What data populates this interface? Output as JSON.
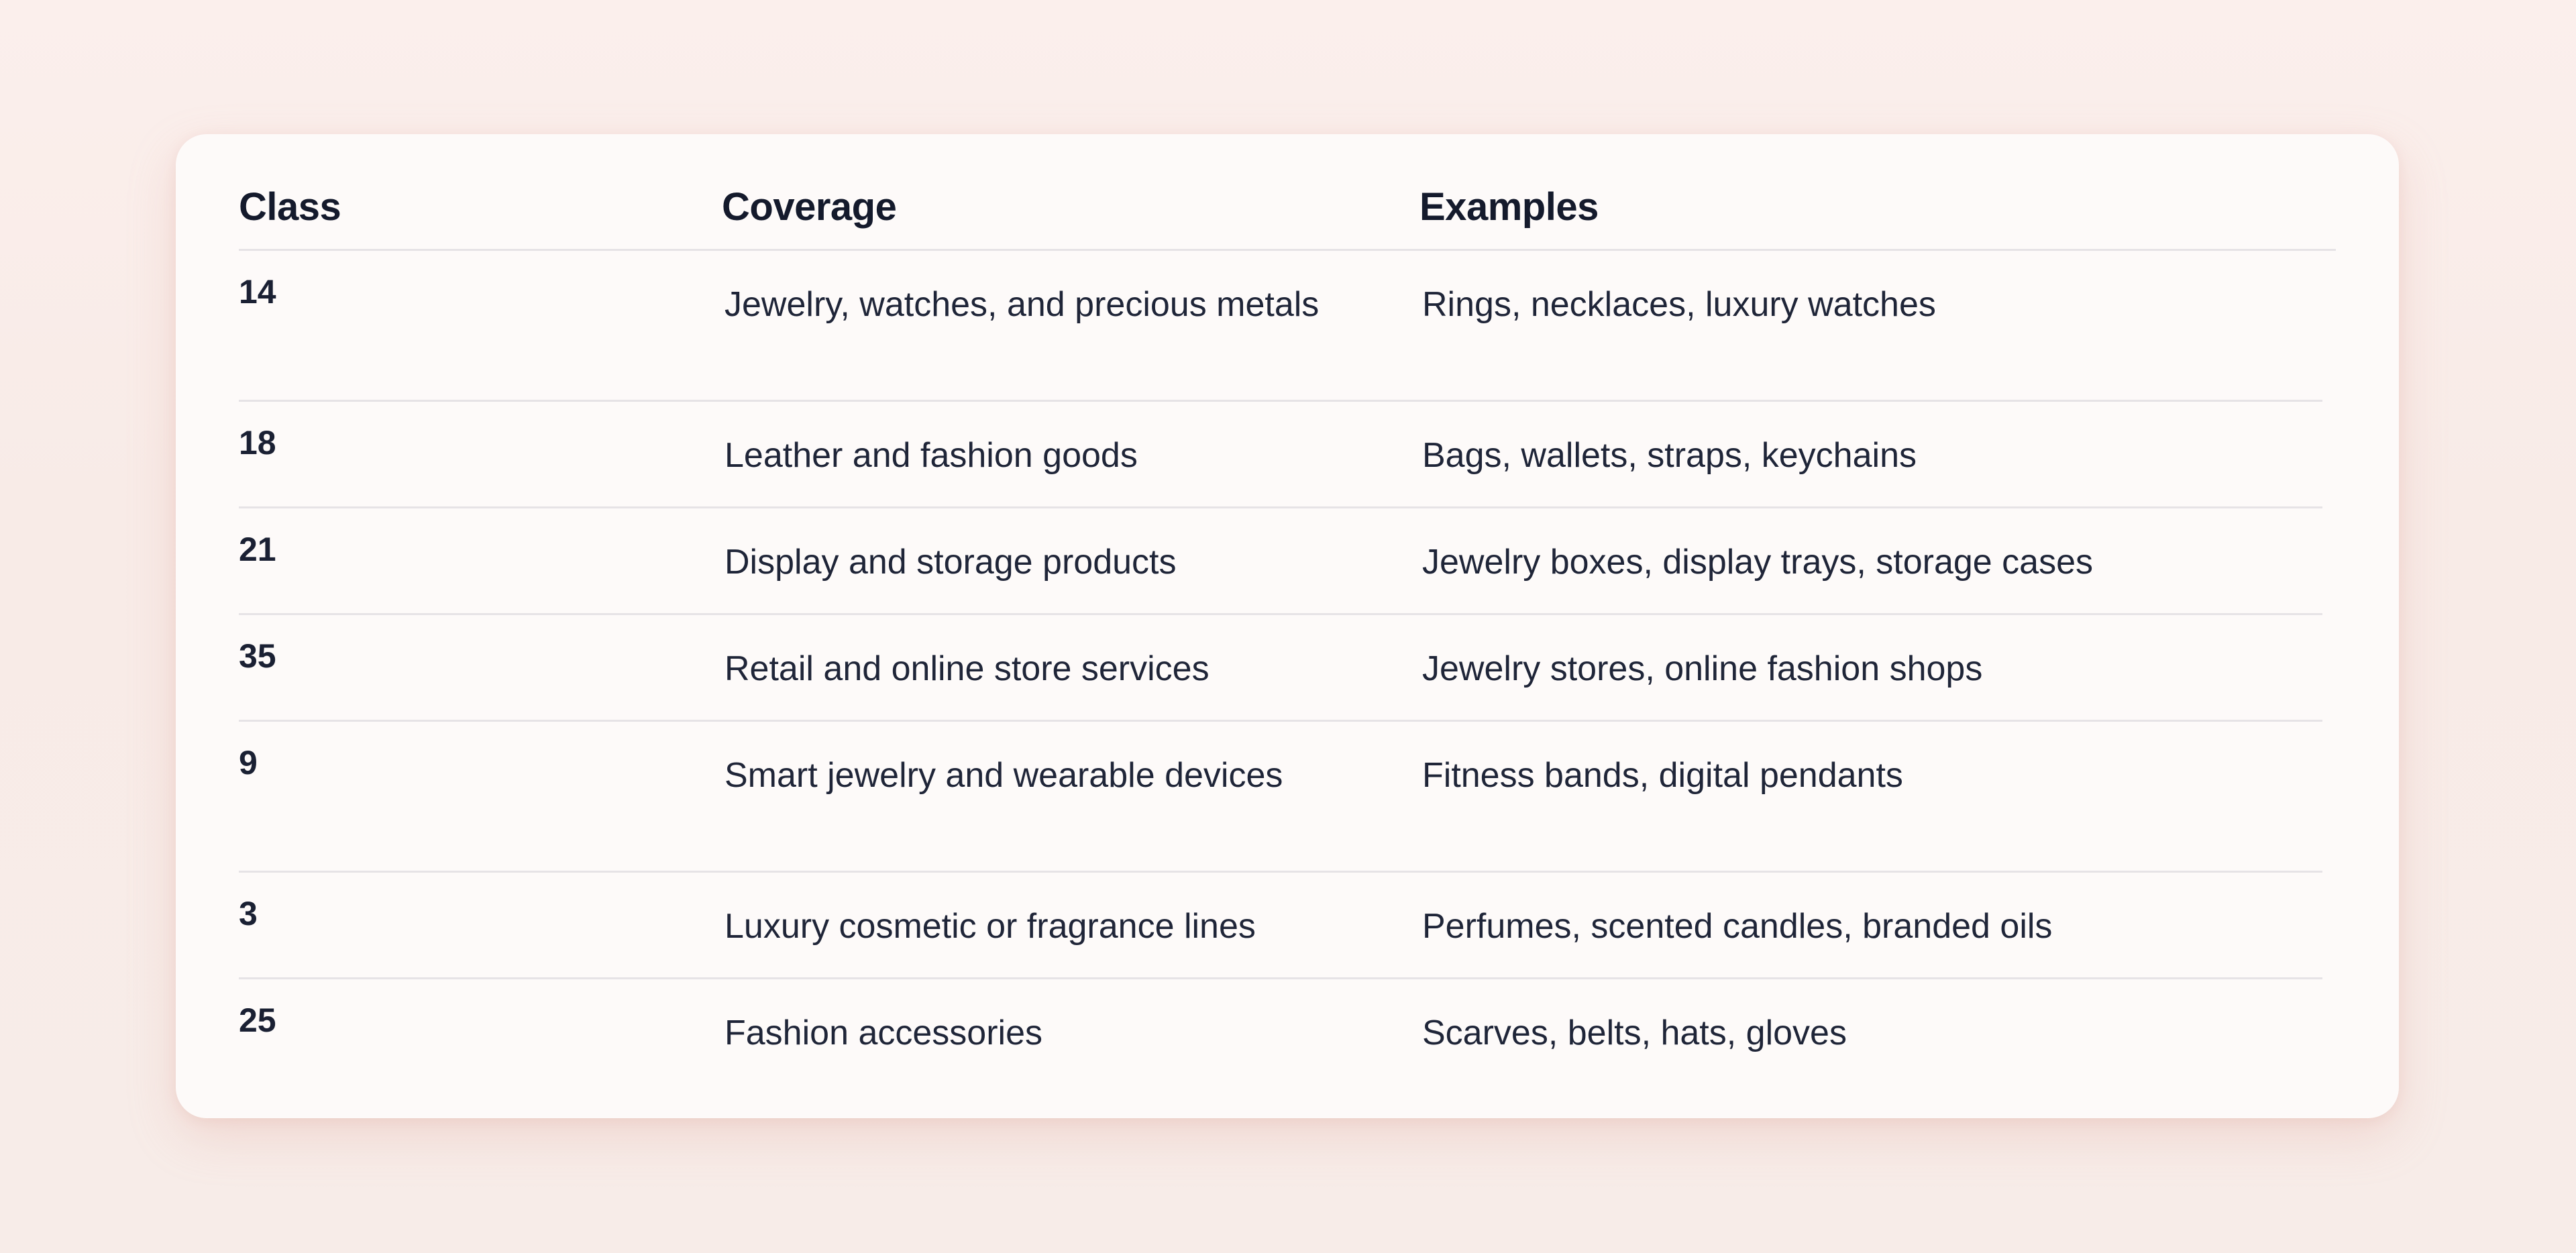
{
  "table": {
    "headers": {
      "class": "Class",
      "coverage": "Coverage",
      "examples": "Examples"
    },
    "rows": [
      {
        "class": "14",
        "coverage": "Jewelry, watches, and precious metals",
        "examples": "Rings, necklaces, luxury watches"
      },
      {
        "class": "18",
        "coverage": "Leather and fashion goods",
        "examples": "Bags, wallets, straps, keychains"
      },
      {
        "class": "21",
        "coverage": "Display and storage products",
        "examples": "Jewelry boxes, display trays, storage cases"
      },
      {
        "class": "35",
        "coverage": "Retail and online store services",
        "examples": "Jewelry stores, online fashion shops"
      },
      {
        "class": "9",
        "coverage": "Smart jewelry and wearable devices",
        "examples": "Fitness bands, digital pendants"
      },
      {
        "class": "3",
        "coverage": "Luxury cosmetic or fragrance lines",
        "examples": "Perfumes, scented candles, branded oils"
      },
      {
        "class": "25",
        "coverage": "Fashion accessories",
        "examples": "Scarves, belts, hats, gloves"
      }
    ]
  }
}
